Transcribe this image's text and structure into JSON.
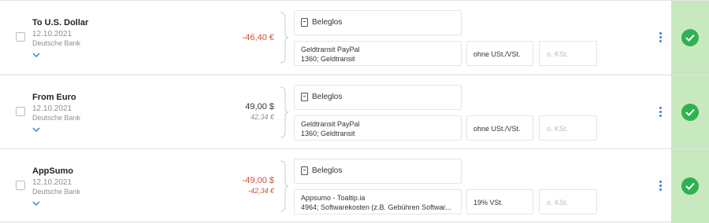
{
  "transactions": [
    {
      "title": "To U.S. Dollar",
      "date": "12.10.2021",
      "bank": "Deutsche Bank",
      "amount": "-46,40 €",
      "amount_secondary": "",
      "receipt_label": "Beleglos",
      "account_line1": "Geldtransit PayPal",
      "account_line2": "1360; Geldtransit",
      "vat": "ohne USt./VSt.",
      "cost_center_placeholder": "o. KSt.",
      "status": "booked"
    },
    {
      "title": "From Euro",
      "date": "12.10.2021",
      "bank": "Deutsche Bank",
      "amount": "49,00 $",
      "amount_secondary": "42,34 €",
      "receipt_label": "Beleglos",
      "account_line1": "Geldtransit PayPal",
      "account_line2": "1360; Geldtransit",
      "vat": "ohne USt./VSt.",
      "cost_center_placeholder": "o. KSt.",
      "status": "booked"
    },
    {
      "title": "AppSumo",
      "date": "12.10.2021",
      "bank": "Deutsche Bank",
      "amount": "-49,00 $",
      "amount_secondary": "-42,34 €",
      "receipt_label": "Beleglos",
      "account_line1": "Appsumo - Toaltip.ia",
      "account_line2": "4964; Softwarekosten (z.B. Gebühren Softwar...",
      "vat": "19% VSt.",
      "cost_center_placeholder": "o. KSt.",
      "status": "booked"
    }
  ],
  "colors": {
    "negative": "#c8513a",
    "accent": "#3b7fd1",
    "status_bg": "#c8e8be",
    "status_check": "#2fb150"
  },
  "icons": {
    "checkbox": "checkbox-icon",
    "expand": "chevron-down-icon",
    "receipt": "document-icon",
    "menu": "more-vertical-icon",
    "status": "check-circle-icon"
  }
}
